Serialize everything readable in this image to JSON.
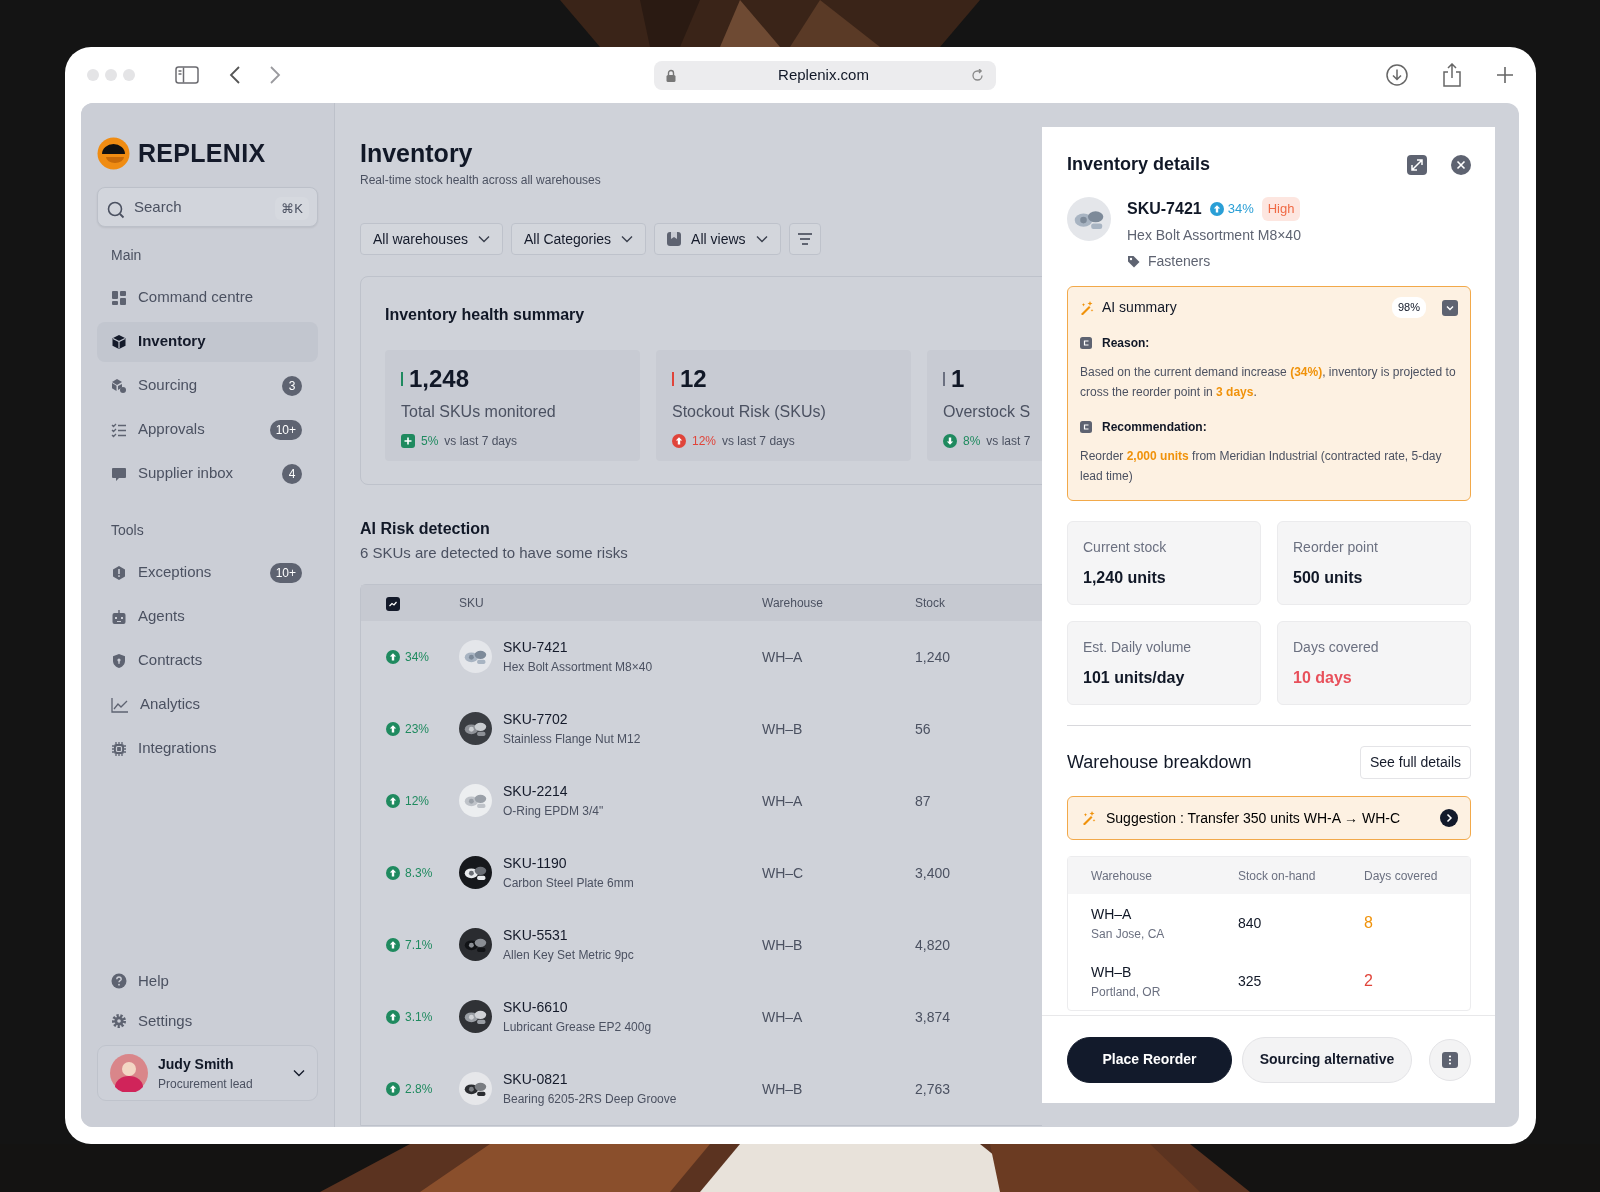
{
  "browser": {
    "url": "Replenix.com"
  },
  "sidebar": {
    "brand": "REPLENIX",
    "search": {
      "placeholder": "Search",
      "shortcut": "⌘K"
    },
    "sections": [
      {
        "title": "Main",
        "items": [
          {
            "label": "Command centre",
            "selected": false
          },
          {
            "label": "Inventory",
            "selected": true
          },
          {
            "label": "Sourcing",
            "selected": false,
            "badge": "3"
          },
          {
            "label": "Approvals",
            "selected": false,
            "badge": "10+"
          },
          {
            "label": "Supplier inbox",
            "selected": false,
            "badge": "4"
          }
        ]
      },
      {
        "title": "Tools",
        "items": [
          {
            "label": "Exceptions",
            "selected": false,
            "badge": "10+"
          },
          {
            "label": "Agents",
            "selected": false
          },
          {
            "label": "Contracts",
            "selected": false
          },
          {
            "label": "Analytics",
            "selected": false
          },
          {
            "label": "Integrations",
            "selected": false
          }
        ]
      }
    ],
    "bottom_items": [
      {
        "label": "Help"
      },
      {
        "label": "Settings"
      }
    ],
    "user": {
      "name": "Judy Smith",
      "role": "Procurement lead"
    }
  },
  "page": {
    "title": "Inventory",
    "subtitle": "Real-time stock health across all warehouses",
    "filters": [
      {
        "label": "All warehouses",
        "kind": "dropdown"
      },
      {
        "label": "All Categories",
        "kind": "dropdown"
      },
      {
        "label": "All views",
        "kind": "views"
      }
    ],
    "health_summary": {
      "title": "Inventory health summary",
      "stats": [
        {
          "value": "1,248",
          "label": "Total SKUs monitored",
          "delta": "5%",
          "delta_text": "vs last 7 days",
          "kind": "plus",
          "positive": true,
          "color": "#1f8a5f"
        },
        {
          "value": "12",
          "label": "Stockout Risk (SKUs)",
          "delta": "12%",
          "delta_text": "vs last 7 days",
          "kind": "up",
          "positive": false,
          "color": "#e0443a"
        },
        {
          "value": "1",
          "label": "Overstock S",
          "delta": "8%",
          "delta_text": "vs last 7",
          "kind": "down",
          "positive": true,
          "color": "#6b7080"
        }
      ]
    },
    "risk_detection": {
      "title": "AI Risk detection",
      "subtitle": "6 SKUs are detected to have some risks",
      "columns": [
        "SKU",
        "Warehouse",
        "Stock"
      ],
      "rows": [
        {
          "change": "34%",
          "sku": "SKU-7421",
          "name": "Hex Bolt Assortment M8×40",
          "warehouse": "WH–A",
          "stock": "1,240"
        },
        {
          "change": "23%",
          "sku": "SKU-7702",
          "name": "Stainless Flange Nut M12",
          "warehouse": "WH–B",
          "stock": "56"
        },
        {
          "change": "12%",
          "sku": "SKU-2214",
          "name": "O-Ring EPDM 3/4\"",
          "warehouse": "WH–A",
          "stock": "87"
        },
        {
          "change": "8.3%",
          "sku": "SKU-1190",
          "name": "Carbon Steel Plate 6mm",
          "warehouse": "WH–C",
          "stock": "3,400"
        },
        {
          "change": "7.1%",
          "sku": "SKU-5531",
          "name": "Allen Key Set Metric 9pc",
          "warehouse": "WH–B",
          "stock": "4,820"
        },
        {
          "change": "3.1%",
          "sku": "SKU-6610",
          "name": "Lubricant Grease EP2 400g",
          "warehouse": "WH–A",
          "stock": "3,874"
        },
        {
          "change": "2.8%",
          "sku": "SKU-0821",
          "name": "Bearing 6205-2RS Deep Groove",
          "warehouse": "WH–B",
          "stock": "2,763"
        }
      ]
    }
  },
  "details": {
    "title": "Inventory details",
    "sku": "SKU-7421",
    "change": "34%",
    "priority": "High",
    "name": "Hex Bolt Assortment M8×40",
    "category": "Fasteners",
    "ai_summary": {
      "title": "AI summary",
      "confidence": "98%",
      "sections": [
        {
          "heading": "Reason:",
          "text": "Based on the current demand increase **(34%)**, inventory is projected to cross the reorder point in **3 days**."
        },
        {
          "heading": "Recommendation:",
          "text": "Reorder **2,000 units** from Meridian Industrial (contracted rate, 5-day lead time)"
        }
      ]
    },
    "metrics": [
      {
        "label": "Current stock",
        "value": "1,240 units",
        "kind": "normal"
      },
      {
        "label": "Reorder point",
        "value": "500 units",
        "kind": "normal"
      },
      {
        "label": "Est. Daily volume",
        "value": "101 units/day",
        "kind": "normal"
      },
      {
        "label": "Days covered",
        "value": "10 days",
        "kind": "alert"
      }
    ],
    "breakdown": {
      "title": "Warehouse breakdown",
      "action": "See full details",
      "suggestion": "Suggestion : Transfer 350 units WH-A → WH-C",
      "columns": [
        "Warehouse",
        "Stock on-hand",
        "Days covered"
      ],
      "rows": [
        {
          "warehouse": "WH–A",
          "location": "San Jose, CA",
          "stock": "840",
          "days": "8",
          "kind": "warning"
        },
        {
          "warehouse": "WH–B",
          "location": "Portland, OR",
          "stock": "325",
          "days": "2",
          "kind": "critical"
        }
      ]
    },
    "actions": [
      {
        "label": "Place Reorder",
        "kind": "primary"
      },
      {
        "label": "Sourcing alternative",
        "kind": "secondary"
      }
    ]
  }
}
